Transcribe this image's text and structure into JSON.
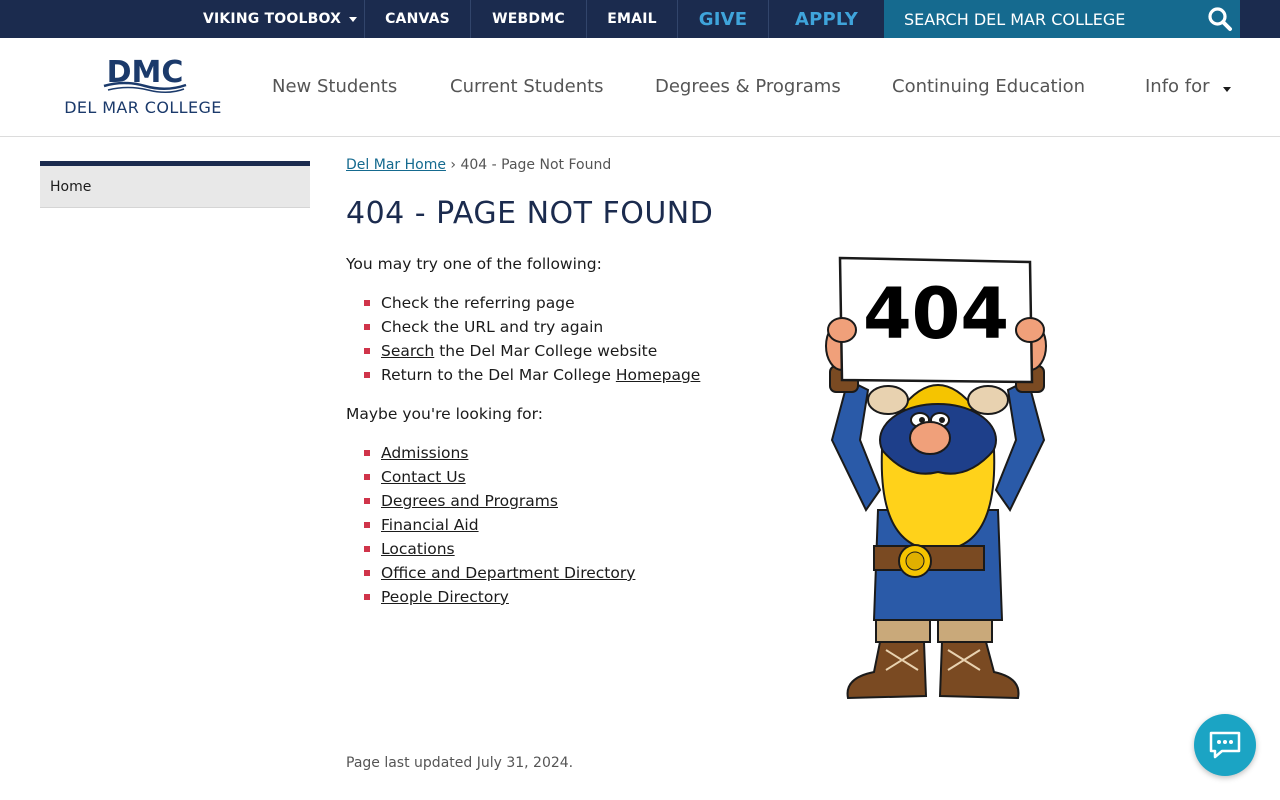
{
  "topbar": {
    "viking_toolbox": "VIKING TOOLBOX",
    "canvas": "CANVAS",
    "webdmc": "WEBDMC",
    "email": "EMAIL",
    "give": "GIVE",
    "apply": "APPLY",
    "search_placeholder": "SEARCH DEL MAR COLLEGE"
  },
  "header": {
    "logo_mark": "DMC",
    "logo_text": "DEL MAR COLLEGE",
    "nav": [
      "New Students",
      "Current Students",
      "Degrees & Programs",
      "Continuing Education",
      "Info for"
    ]
  },
  "sidebar": {
    "home": "Home"
  },
  "breadcrumb": {
    "home_link": "Del Mar Home",
    "separator": "›",
    "current": "404 - Page Not Found"
  },
  "main": {
    "title": "404 - PAGE NOT FOUND",
    "intro": "You may try one of the following:",
    "suggestions": {
      "item1": "Check the referring page",
      "item2": "Check the URL and try again",
      "item3_link": "Search",
      "item3_rest": " the Del Mar College website",
      "item4_pre": "Return to the Del Mar College ",
      "item4_link": "Homepage"
    },
    "looking_for": "Maybe you're looking for:",
    "links": [
      "Admissions",
      "Contact Us",
      "Degrees and Programs",
      "Financial Aid",
      "Locations",
      "Office and Department Directory",
      "People Directory"
    ],
    "updated": "Page last updated July 31, 2024."
  },
  "mascot": {
    "sign_text": "404"
  },
  "colors": {
    "navy": "#1b2b4e",
    "accent_blue": "#3fa4db",
    "search_teal": "#156a8f",
    "bullet_red": "#d0344a",
    "chat_teal": "#1ba4c4"
  },
  "icons": {
    "search": "search-icon",
    "chat": "chat-bubble-icon",
    "dropdown": "caret-down-icon"
  }
}
